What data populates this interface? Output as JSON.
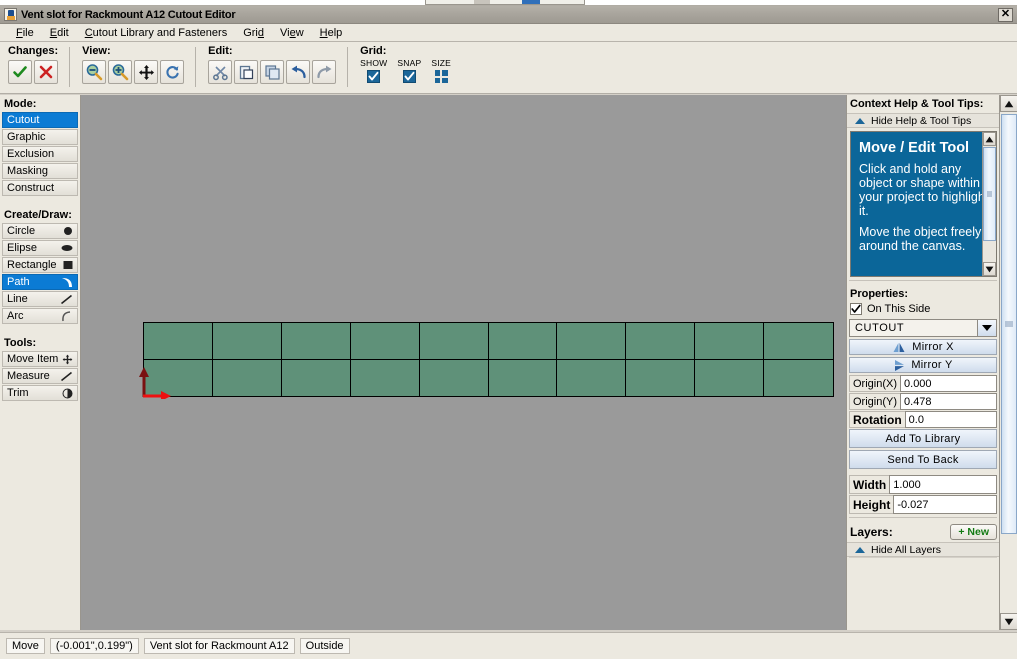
{
  "window": {
    "title": "Vent slot for Rackmount A12 Cutout Editor",
    "close_label": "✕",
    "app_icon": "java-coffee-cup-icon"
  },
  "menubar": {
    "items": [
      {
        "label": "File",
        "mnemonic": "F"
      },
      {
        "label": "Edit",
        "mnemonic": "E"
      },
      {
        "label": "Cutout Library and Fasteners",
        "mnemonic": "C"
      },
      {
        "label": "Grid",
        "mnemonic": "d"
      },
      {
        "label": "View",
        "mnemonic": "e"
      },
      {
        "label": "Help",
        "mnemonic": "H"
      }
    ]
  },
  "toolbar": {
    "changes": {
      "label": "Changes:",
      "buttons": [
        {
          "name": "accept-changes-button",
          "icon": "check-icon",
          "color": "#1f8a1f"
        },
        {
          "name": "reject-changes-button",
          "icon": "cross-icon",
          "color": "#cc2222"
        }
      ]
    },
    "view": {
      "label": "View:",
      "buttons": [
        {
          "name": "zoom-out-button",
          "icon": "magnifier-minus-icon"
        },
        {
          "name": "zoom-in-button",
          "icon": "magnifier-plus-icon"
        },
        {
          "name": "pan-button",
          "icon": "move-arrows-icon"
        },
        {
          "name": "refresh-button",
          "icon": "refresh-icon"
        }
      ]
    },
    "edit": {
      "label": "Edit:",
      "buttons": [
        {
          "name": "cut-button",
          "icon": "scissors-icon"
        },
        {
          "name": "paste-button",
          "icon": "clipboard-icon"
        },
        {
          "name": "copy-button",
          "icon": "copy-icon"
        },
        {
          "name": "undo-button",
          "icon": "undo-arrow-icon"
        },
        {
          "name": "redo-button",
          "icon": "redo-arrow-icon"
        }
      ]
    },
    "grid": {
      "label": "Grid:",
      "show_label": "SHOW",
      "show_checked": true,
      "snap_label": "SNAP",
      "snap_checked": true,
      "size_label": "SIZE",
      "size_icon": "grid-size-icon"
    }
  },
  "left_panel": {
    "mode_title": "Mode:",
    "modes": [
      {
        "label": "Cutout",
        "selected": true
      },
      {
        "label": "Graphic",
        "selected": false
      },
      {
        "label": "Exclusion",
        "selected": false
      },
      {
        "label": "Masking",
        "selected": false
      },
      {
        "label": "Construct",
        "selected": false
      }
    ],
    "create_title": "Create/Draw:",
    "create_items": [
      {
        "label": "Circle",
        "icon": "filled-circle-icon",
        "selected": false
      },
      {
        "label": "Elipse",
        "icon": "filled-ellipse-icon",
        "selected": false
      },
      {
        "label": "Rectangle",
        "icon": "filled-square-icon",
        "selected": false
      },
      {
        "label": "Path",
        "icon": "path-curve-icon",
        "selected": true
      },
      {
        "label": "Line",
        "icon": "line-icon",
        "selected": false
      },
      {
        "label": "Arc",
        "icon": "arc-icon",
        "selected": false
      }
    ],
    "tools_title": "Tools:",
    "tools": [
      {
        "label": "Move Item",
        "icon": "move-arrows-icon",
        "selected": false
      },
      {
        "label": "Measure",
        "icon": "ruler-pencil-icon",
        "selected": false
      },
      {
        "label": "Trim",
        "icon": "trim-icon",
        "selected": false
      }
    ]
  },
  "canvas": {
    "background_color": "#9a9a9a",
    "shape": {
      "name": "vent-slot-grid-shape",
      "fill_color": "#5f9179",
      "stroke_color": "#000000",
      "columns": 10,
      "rows": 2
    },
    "origin_marker": {
      "name": "origin-axis-marker",
      "x_axis_color": "#ee1111",
      "y_axis_color": "#7a1111"
    }
  },
  "right_panel": {
    "help": {
      "title": "Context Help & Tool Tips:",
      "hide_label": "Hide Help & Tool Tips",
      "heading": "Move / Edit Tool",
      "paragraphs": [
        "Click and hold any object or shape within your project to highlight it.",
        "Move the object freely around the canvas."
      ],
      "accent_color": "#0b6699"
    },
    "properties": {
      "title": "Properties:",
      "on_this_side_label": "On This Side",
      "on_this_side_checked": true,
      "type_value": "CUTOUT",
      "mirror_x_label": "Mirror X",
      "mirror_y_label": "Mirror Y",
      "origin_x_label": "Origin(X)",
      "origin_x_value": "0.000",
      "origin_y_label": "Origin(Y)",
      "origin_y_value": "0.478",
      "rotation_label": "Rotation",
      "rotation_value": "0.0",
      "add_to_library_label": "Add To Library",
      "send_to_back_label": "Send To Back",
      "width_label": "Width",
      "width_value": "1.000",
      "height_label": "Height",
      "height_value": "-0.027"
    },
    "layers": {
      "title": "Layers:",
      "new_label": "+ New",
      "hide_all_label": "Hide All Layers"
    }
  },
  "status_bar": {
    "mode": "Move",
    "coordinates": "(-0.001\",0.199\")",
    "document": "Vent slot for Rackmount A12",
    "side": "Outside"
  }
}
